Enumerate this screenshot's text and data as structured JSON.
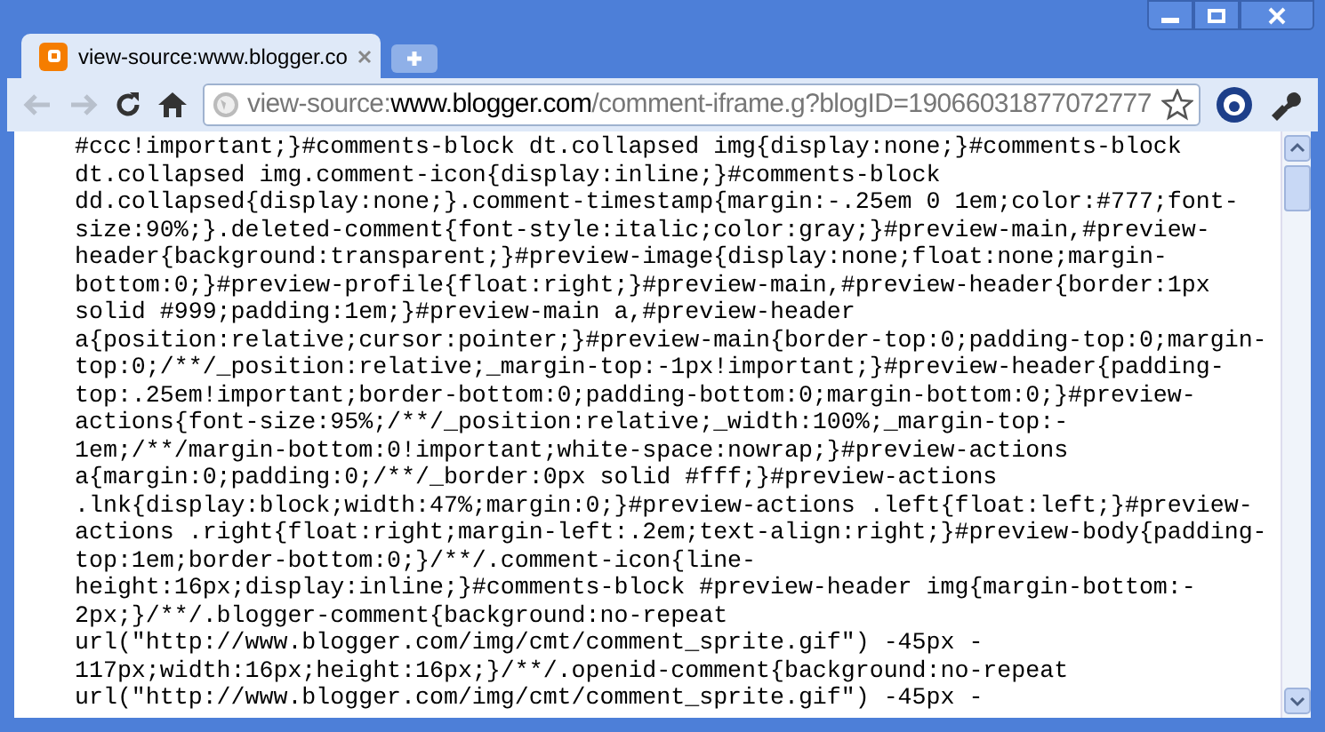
{
  "tabs": [
    {
      "title": "view-source:www.blogger.co",
      "selected": true
    }
  ],
  "address_bar": {
    "scheme": "view-source:",
    "host": "www.blogger.com",
    "path": "/comment-iframe.g?blogID=19066031877072777"
  },
  "source_lines": [
    "#ccc!important;}#comments-block dt.collapsed img{display:none;}#comments-block",
    "dt.collapsed img.comment-icon{display:inline;}#comments-block",
    "dd.collapsed{display:none;}.comment-timestamp{margin:-.25em 0 1em;color:#777;font-",
    "size:90%;}.deleted-comment{font-style:italic;color:gray;}#preview-main,#preview-",
    "header{background:transparent;}#preview-image{display:none;float:none;margin-",
    "bottom:0;}#preview-profile{float:right;}#preview-main,#preview-header{border:1px",
    "solid #999;padding:1em;}#preview-main a,#preview-header",
    "a{position:relative;cursor:pointer;}#preview-main{border-top:0;padding-top:0;margin-",
    "top:0;/**/_position:relative;_margin-top:-1px!important;}#preview-header{padding-",
    "top:.25em!important;border-bottom:0;padding-bottom:0;margin-bottom:0;}#preview-",
    "actions{font-size:95%;/**/_position:relative;_width:100%;_margin-top:-",
    "1em;/**/margin-bottom:0!important;white-space:nowrap;}#preview-actions",
    "a{margin:0;padding:0;/**/_border:0px solid #fff;}#preview-actions",
    ".lnk{display:block;width:47%;margin:0;}#preview-actions .left{float:left;}#preview-",
    "actions .right{float:right;margin-left:.2em;text-align:right;}#preview-body{padding-",
    "top:1em;border-bottom:0;}/**/.comment-icon{line-",
    "height:16px;display:inline;}#comments-block #preview-header img{margin-bottom:-",
    "2px;}/**/.blogger-comment{background:no-repeat",
    "url(\"http://www.blogger.com/img/cmt/comment_sprite.gif\") -45px -",
    "117px;width:16px;height:16px;}/**/.openid-comment{background:no-repeat",
    "url(\"http://www.blogger.com/img/cmt/comment_sprite.gif\") -45px -"
  ]
}
